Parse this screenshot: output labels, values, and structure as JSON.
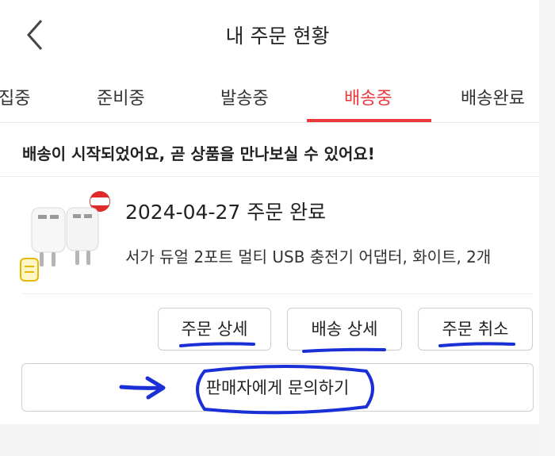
{
  "header": {
    "title": "내 주문 현황",
    "back_icon": "chevron-left-icon"
  },
  "tabs": [
    {
      "label": "집중",
      "active": false
    },
    {
      "label": "준비중",
      "active": false
    },
    {
      "label": "발송중",
      "active": false
    },
    {
      "label": "배송중",
      "active": true
    },
    {
      "label": "배송완료",
      "active": false
    }
  ],
  "notice": "배송이 시작되었어요, 곧 상품을 만나보실 수 있어요!",
  "order": {
    "date_status": "2024-04-27 주문 완료",
    "product_name": "서가 듀얼 2포트 멀티 USB 충전기 어댑터, 화이트, 2개",
    "image_icon": "usb-charger-product-image"
  },
  "buttons": {
    "order_detail": "주문 상세",
    "shipping_detail": "배송 상세",
    "order_cancel": "주문 취소",
    "contact_seller": "판매자에게 문의하기"
  },
  "colors": {
    "accent": "#e8383d",
    "annotation": "#1a2fd6"
  }
}
